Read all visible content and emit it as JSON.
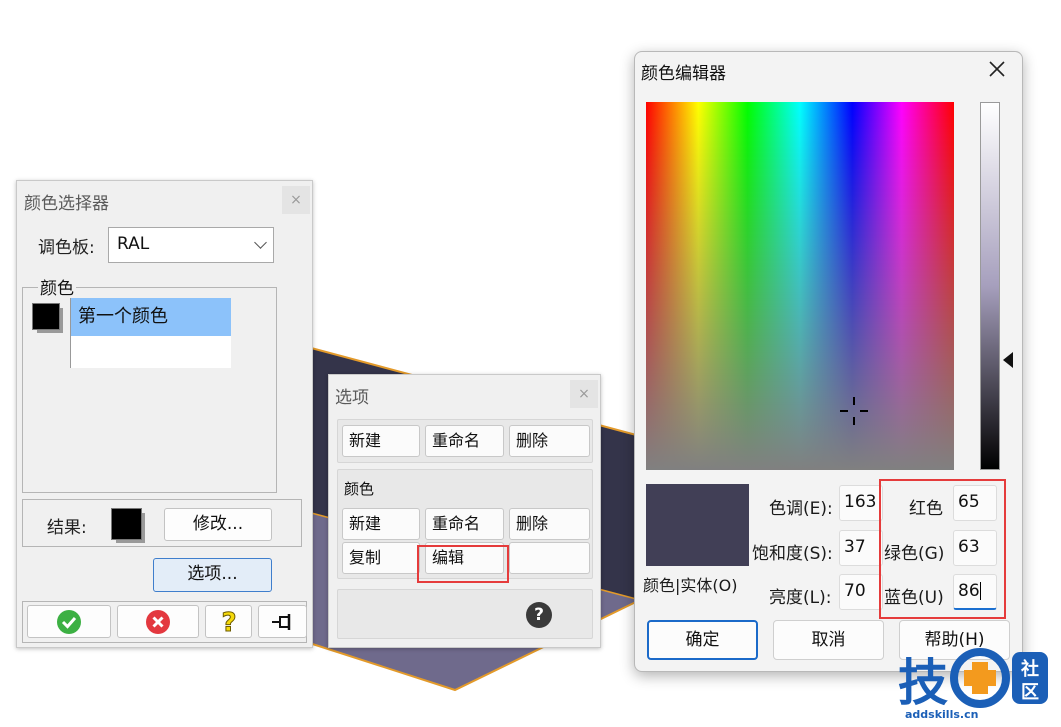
{
  "picker": {
    "title": "颜色选择器",
    "close": "×",
    "palette_label": "调色板:",
    "palette_value": "RAL",
    "group_label": "颜色",
    "selected_color": "第一个颜色",
    "result_label": "结果:",
    "modify_button": "修改...",
    "options_button": "选项...",
    "bottom_icons": [
      "ok-check-icon",
      "cancel-x-icon",
      "help-question-icon",
      "pin-icon"
    ],
    "colors": {
      "ok": "#3cb043",
      "cancel": "#e3383f",
      "help": "#f5d90a"
    }
  },
  "options": {
    "title": "选项",
    "close": "×",
    "palette_row": [
      "新建",
      "重命名",
      "删除"
    ],
    "color_group_label": "颜色",
    "color_row1": [
      "新建",
      "重命名",
      "删除"
    ],
    "color_row2": [
      "复制",
      "编辑"
    ],
    "help_icon": "?"
  },
  "editor": {
    "title": "颜色编辑器",
    "hue_label": "色调(E):",
    "hue": "163",
    "sat_label": "饱和度(S):",
    "sat": "37",
    "lum_label": "亮度(L):",
    "lum": "70",
    "red_label": "红色",
    "red": "65",
    "green_label": "绿色(G)",
    "green": "63",
    "blue_label": "蓝色(U)",
    "blue": "86",
    "solid_label": "颜色|实体(O)",
    "ok_button": "确定",
    "cancel_button": "取消",
    "help_button": "帮助(H)",
    "preview_color": "#413f56"
  },
  "watermark": {
    "char": "技",
    "side": [
      "社",
      "区"
    ],
    "url": "addskills.cn",
    "colors": {
      "blue": "#1b5fb7",
      "orange": "#f39a1e"
    }
  }
}
